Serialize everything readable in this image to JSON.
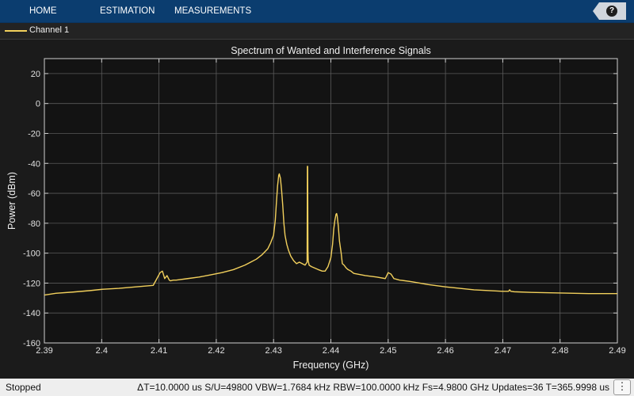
{
  "toolstrip": {
    "tabs": [
      "HOME",
      "ESTIMATION",
      "MEASUREMENTS"
    ],
    "help_label": "?"
  },
  "legend": {
    "channel_label": "Channel 1",
    "color": "#f2d05c"
  },
  "chart_data": {
    "type": "line",
    "title": "Spectrum of Wanted and Interference Signals",
    "xlabel": "Frequency (GHz)",
    "ylabel": "Power (dBm)",
    "xlim": [
      2.39,
      2.49
    ],
    "ylim": [
      -160,
      30
    ],
    "xticks": [
      2.39,
      2.4,
      2.41,
      2.42,
      2.43,
      2.44,
      2.45,
      2.46,
      2.47,
      2.48,
      2.49
    ],
    "xtick_labels": [
      "2.39",
      "2.4",
      "2.41",
      "2.42",
      "2.43",
      "2.44",
      "2.45",
      "2.46",
      "2.47",
      "2.48",
      "2.49"
    ],
    "yticks": [
      20,
      0,
      -20,
      -40,
      -60,
      -80,
      -100,
      -120,
      -140,
      -160
    ],
    "ytick_labels": [
      "20",
      "0",
      "-20",
      "-40",
      "-60",
      "-80",
      "-100",
      "-120",
      "-140",
      "-160"
    ],
    "grid": true,
    "background_color": "#131313",
    "line_color": "#f2d05c",
    "series": [
      {
        "name": "Channel 1",
        "x": [
          2.39,
          2.392,
          2.395,
          2.398,
          2.4,
          2.403,
          2.406,
          2.409,
          2.4095,
          2.4102,
          2.4106,
          2.411,
          2.4114,
          2.4118,
          2.412,
          2.4125,
          2.413,
          2.415,
          2.417,
          2.419,
          2.421,
          2.423,
          2.425,
          2.426,
          2.427,
          2.428,
          2.4285,
          2.429,
          2.4295,
          2.43,
          2.4303,
          2.4305,
          2.4307,
          2.4309,
          2.431,
          2.4312,
          2.4314,
          2.4316,
          2.4318,
          2.432,
          2.4323,
          2.4326,
          2.433,
          2.4335,
          2.434,
          2.4345,
          2.435,
          2.4355,
          2.43585,
          2.4359,
          2.43595,
          2.436,
          2.43605,
          2.4361,
          2.4362,
          2.4366,
          2.4372,
          2.4378,
          2.4385,
          2.439,
          2.4395,
          2.44,
          2.4403,
          2.4405,
          2.4407,
          2.4409,
          2.441,
          2.4411,
          2.4413,
          2.4415,
          2.4418,
          2.442,
          2.4423,
          2.4427,
          2.443,
          2.4435,
          2.444,
          2.446,
          2.448,
          2.4495,
          2.45,
          2.4505,
          2.451,
          2.4515,
          2.452,
          2.454,
          2.457,
          2.46,
          2.465,
          2.47,
          2.471,
          2.4712,
          2.4714,
          2.472,
          2.475,
          2.48,
          2.485,
          2.49
        ],
        "values": [
          -128,
          -126.8,
          -126,
          -125,
          -124.2,
          -123.5,
          -122.5,
          -121.5,
          -118,
          -113,
          -112,
          -117,
          -115,
          -118,
          -118.5,
          -118,
          -118,
          -117,
          -116,
          -114.5,
          -113,
          -111,
          -108,
          -106,
          -104,
          -101,
          -99,
          -97,
          -93,
          -88,
          -78,
          -66,
          -55,
          -48,
          -47,
          -50,
          -58,
          -68,
          -80,
          -88,
          -94,
          -98,
          -102,
          -105,
          -107,
          -106,
          -107,
          -108,
          -106,
          -42,
          -42,
          -98,
          -105,
          -106,
          -108,
          -109,
          -110,
          -111,
          -112,
          -112,
          -109,
          -103,
          -94,
          -84,
          -78,
          -74,
          -73.5,
          -75,
          -82,
          -92,
          -100,
          -107,
          -108,
          -110,
          -111,
          -112,
          -113.5,
          -115,
          -116,
          -117,
          -113,
          -114,
          -117,
          -117.5,
          -118,
          -119,
          -121,
          -122.5,
          -124.5,
          -125.5,
          -125.5,
          -124.5,
          -125.5,
          -125.8,
          -126.2,
          -126.6,
          -127,
          -127
        ]
      }
    ]
  },
  "status": {
    "state": "Stopped",
    "metrics": "ΔT=10.0000 us  S/U=49800  VBW=1.7684 kHz  RBW=100.0000 kHz  Fs=4.9800 GHz  Updates=36  T=365.9998 us",
    "menu_glyph": "⋮"
  }
}
